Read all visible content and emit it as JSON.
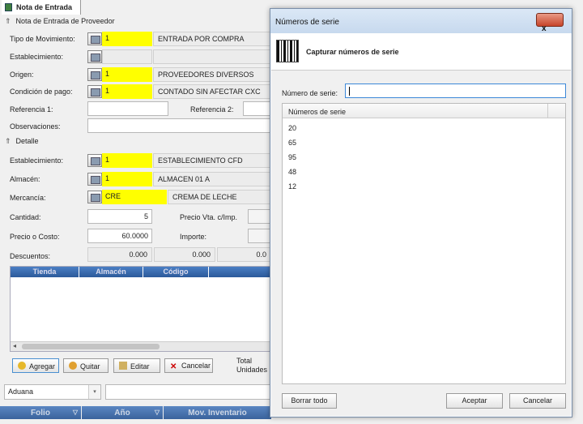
{
  "tab": {
    "title": "Nota de Entrada"
  },
  "sections": {
    "header": "Nota de Entrada de Proveedor",
    "detail": "Detalle"
  },
  "header": {
    "tipo_movimiento": {
      "label": "Tipo de Movimiento:",
      "code": "1",
      "value": "ENTRADA POR COMPRA"
    },
    "establecimiento": {
      "label": "Establecimiento:"
    },
    "origen": {
      "label": "Origen:",
      "code": "1",
      "value": "PROVEEDORES DIVERSOS"
    },
    "condicion_pago": {
      "label": "Condición de pago:",
      "code": "1",
      "value": "CONTADO SIN AFECTAR CXC"
    },
    "referencia1": {
      "label": "Referencia 1:"
    },
    "referencia2": {
      "label": "Referencia 2:"
    },
    "observaciones": {
      "label": "Observaciones:"
    }
  },
  "detail": {
    "establecimiento": {
      "label": "Establecimiento:",
      "code": "1",
      "value": "ESTABLECIMIENTO CFD"
    },
    "almacen": {
      "label": "Almacén:",
      "code": "1",
      "value": "ALMACEN 01 A"
    },
    "mercancia": {
      "label": "Mercancía:",
      "code": "CRE",
      "value": "CREMA DE LECHE"
    },
    "cantidad": {
      "label": "Cantidad:",
      "value": "5"
    },
    "precio_vta": {
      "label": "Precio Vta. c/Imp."
    },
    "precio_costo": {
      "label": "Precio o Costo:",
      "value": "60.0000"
    },
    "importe": {
      "label": "Importe:"
    },
    "descuentos": {
      "label": "Descuentos:",
      "values": [
        "0.000",
        "0.000",
        "0.0"
      ]
    },
    "grid_columns": [
      "Tienda",
      "Almacén",
      "Código"
    ]
  },
  "buttons": {
    "agregar": "Agregar",
    "quitar": "Quitar",
    "editar": "Editar",
    "cancelar": "Cancelar"
  },
  "totals": {
    "label1": "Total",
    "label2": "Unidades"
  },
  "aduana": {
    "value": "Aduana"
  },
  "bottom_grid": {
    "columns": [
      "Folio",
      "Año",
      "Mov. Inventario"
    ]
  },
  "dialog": {
    "title": "Números de serie",
    "close": "x",
    "heading": "Capturar números de serie",
    "input_label": "Número de serie:",
    "input_value": "",
    "list_header": "Números de serie",
    "items": [
      "20",
      "65",
      "95",
      "48",
      "12"
    ],
    "btn_clear": "Borrar todo",
    "btn_ok": "Aceptar",
    "btn_cancel": "Cancelar"
  }
}
